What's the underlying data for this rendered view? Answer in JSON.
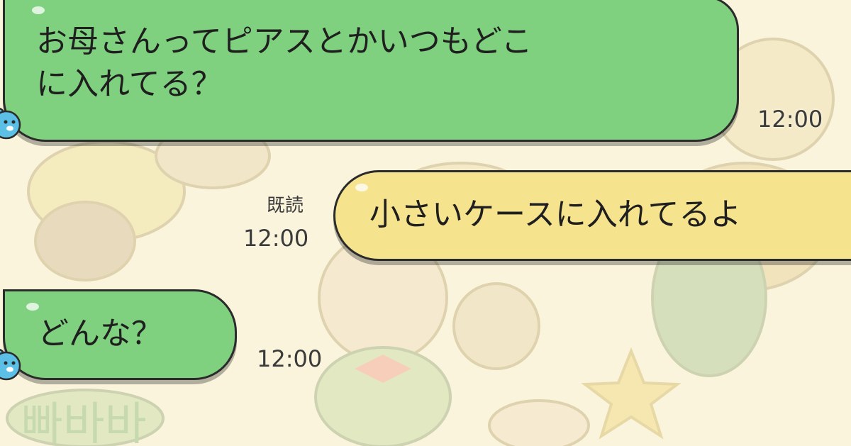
{
  "messages": [
    {
      "side": "left",
      "text_line1": "お母さんってピアスとかいつもどこ",
      "text_line2": "に入れてる？",
      "time": "12:00"
    },
    {
      "side": "right",
      "text": "小さいケースに入れてるよ",
      "read": "既読",
      "time": "12:00"
    },
    {
      "side": "left",
      "text": "どんな？",
      "time": "12:00"
    }
  ],
  "avatar": {
    "icon": "bear-icon",
    "color": "#5bbfe6"
  },
  "colors": {
    "left_bubble": "#7fd17f",
    "right_bubble": "#f6e38e",
    "background": "#fbf4dc",
    "outline": "#2b2b2b"
  },
  "background_art": {
    "lettering": "빠바바"
  }
}
